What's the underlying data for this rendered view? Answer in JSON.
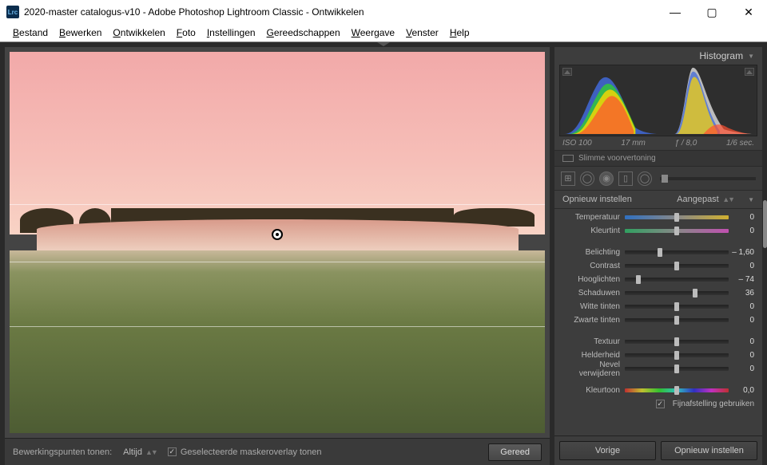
{
  "window": {
    "title": "2020-master catalogus-v10 - Adobe Photoshop Lightroom Classic - Ontwikkelen",
    "app_icon_text": "Lrc"
  },
  "menu": [
    "Bestand",
    "Bewerken",
    "Ontwikkelen",
    "Foto",
    "Instellingen",
    "Gereedschappen",
    "Weergave",
    "Venster",
    "Help"
  ],
  "histogram": {
    "title": "Histogram"
  },
  "exif": {
    "iso": "ISO 100",
    "focal": "17 mm",
    "aperture": "ƒ / 8,0",
    "shutter": "1/6 sec."
  },
  "smart_preview": "Slimme voorvertoning",
  "dev_header": {
    "reset": "Opnieuw instellen",
    "preset": "Aangepast"
  },
  "sliders": {
    "temperatuur": {
      "label": "Temperatuur",
      "value": "0",
      "pos": 50,
      "track": "temp"
    },
    "kleurtint": {
      "label": "Kleurtint",
      "value": "0",
      "pos": 50,
      "track": "tint"
    },
    "belichting": {
      "label": "Belichting",
      "value": "– 1,60",
      "pos": 34
    },
    "contrast": {
      "label": "Contrast",
      "value": "0",
      "pos": 50
    },
    "hooglichten": {
      "label": "Hooglichten",
      "value": "– 74",
      "pos": 13
    },
    "schaduwen": {
      "label": "Schaduwen",
      "value": "36",
      "pos": 68
    },
    "witte": {
      "label": "Witte tinten",
      "value": "0",
      "pos": 50
    },
    "zwarte": {
      "label": "Zwarte tinten",
      "value": "0",
      "pos": 50
    },
    "textuur": {
      "label": "Textuur",
      "value": "0",
      "pos": 50
    },
    "helderheid": {
      "label": "Helderheid",
      "value": "0",
      "pos": 50
    },
    "nevel": {
      "label": "Nevel verwijderen",
      "value": "0",
      "pos": 50
    },
    "kleurtoon": {
      "label": "Kleurtoon",
      "value": "0,0",
      "pos": 50,
      "track": "hue"
    }
  },
  "fine_tune": "Fijnafstelling gebruiken",
  "bottom": {
    "edit_points_label": "Bewerkingspunten tonen:",
    "edit_points_value": "Altijd",
    "mask_overlay": "Geselecteerde maskeroverlay tonen",
    "done": "Gereed"
  },
  "buttons": {
    "prev": "Vorige",
    "reset": "Opnieuw instellen"
  }
}
